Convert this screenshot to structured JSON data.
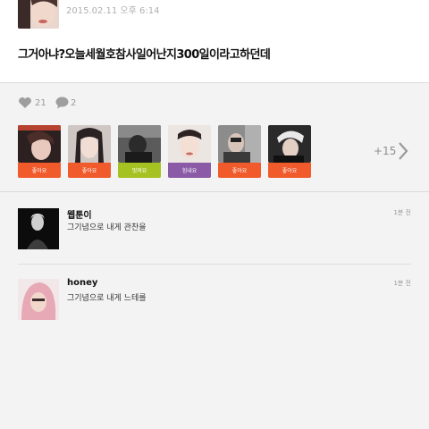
{
  "post": {
    "timestamp": "2015.02.11 오후 6:14",
    "text": "그거아냐?오늘세월호참사일어난지300일이라고하던데"
  },
  "stats": {
    "like_icon": "heart-icon",
    "like_count": "21",
    "comment_icon": "speech-bubble-icon",
    "comment_count": "2"
  },
  "likers": [
    {
      "label": "좋아요",
      "tag_color": "#f15a2b"
    },
    {
      "label": "좋아요",
      "tag_color": "#f15a2b"
    },
    {
      "label": "멋져요",
      "tag_color": "#a6c222"
    },
    {
      "label": "힘내요",
      "tag_color": "#8a5aa6"
    },
    {
      "label": "좋아요",
      "tag_color": "#f15a2b"
    },
    {
      "label": "좋아요",
      "tag_color": "#f15a2b"
    }
  ],
  "more_likers": "+15",
  "comments": [
    {
      "name": "웹툰이",
      "text": "그기념으로 내게 관찬을",
      "time": "1분 전"
    },
    {
      "name": "honey",
      "text": "그기념으로 내게 느테를",
      "time": "1분 전"
    }
  ]
}
